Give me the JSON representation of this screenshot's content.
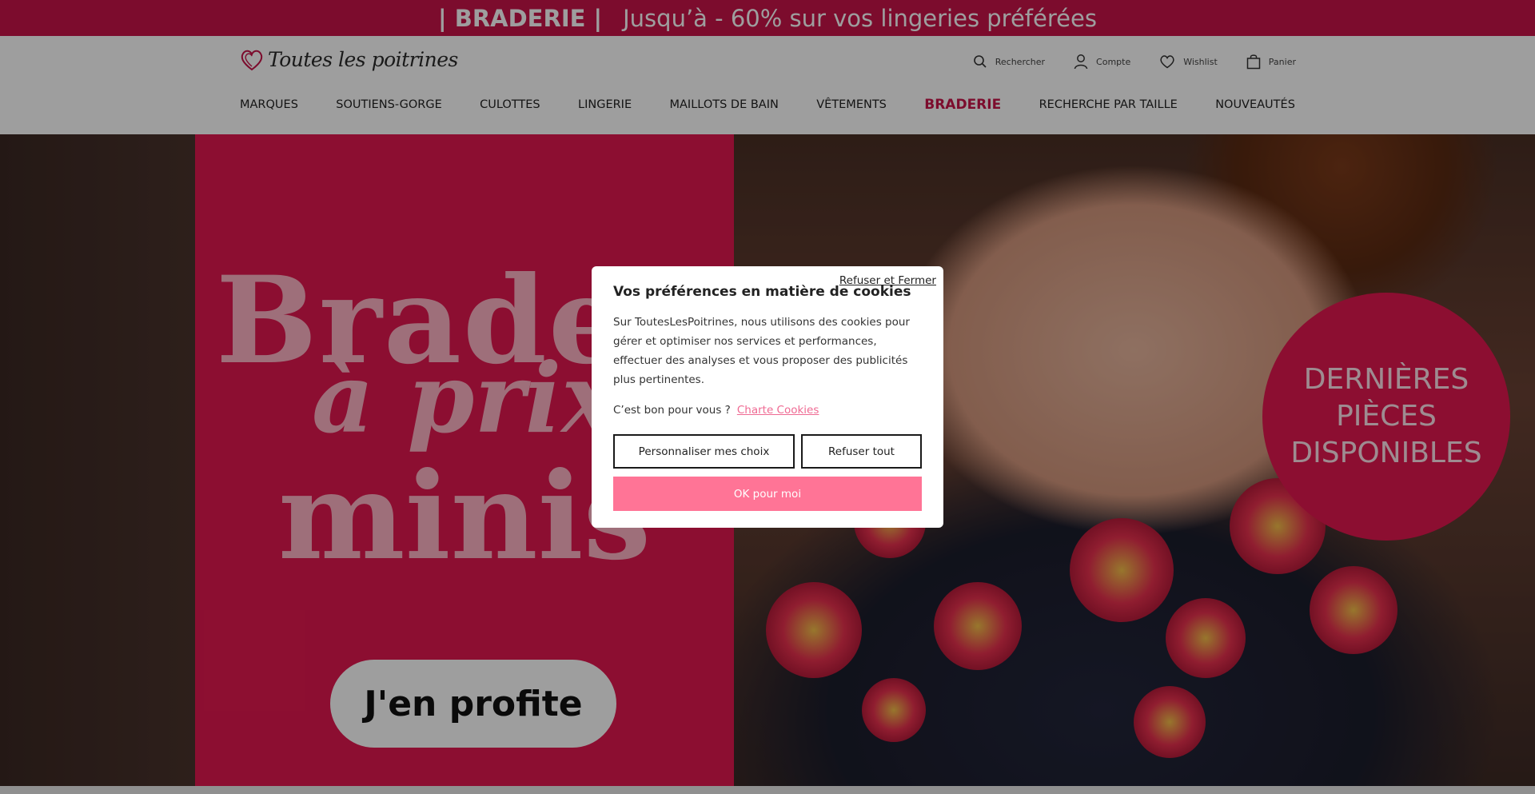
{
  "promo": {
    "highlight": "| BRADERIE |",
    "text": "Jusqu’à - 60% sur vos lingeries préférées"
  },
  "header": {
    "logo_text": "Toutes les poitrines",
    "utils": {
      "search": "Rechercher",
      "account": "Compte",
      "wishlist": "Wishlist",
      "cart": "Panier"
    },
    "nav": [
      {
        "label": "MARQUES"
      },
      {
        "label": "SOUTIENS-GORGE"
      },
      {
        "label": "CULOTTES"
      },
      {
        "label": "LINGERIE"
      },
      {
        "label": "MAILLOTS DE BAIN"
      },
      {
        "label": "VÊTEMENTS"
      },
      {
        "label": "BRADERIE",
        "highlight": true
      },
      {
        "label": "RECHERCHE PAR TAILLE"
      },
      {
        "label": "NOUVEAUTÉS"
      }
    ]
  },
  "hero": {
    "line1": "Braderie",
    "line2": "à prix",
    "line3": "minis",
    "cta": "J'en profite",
    "badge": {
      "line1": "DERNIÈRES",
      "line2": "PIÈCES",
      "line3": "DISPONIBLES"
    }
  },
  "cookie_modal": {
    "close_label": "Refuser et Fermer",
    "title": "Vos préférences en matière de cookies",
    "body": "Sur ToutesLesPoitrines, nous utilisons des cookies pour gérer et optimiser nos services et performances, effectuer des analyses et vous proposer des publicités plus pertinentes.",
    "question": "C’est bon pour vous ?",
    "link": "Charte Cookies",
    "btn_customize": "Personnaliser mes choix",
    "btn_refuse": "Refuser tout",
    "btn_ok": "OK pour moi"
  },
  "colors": {
    "brand": "#c8144a",
    "hero_red": "#e3184f",
    "ok_button": "#ff7496",
    "link": "#ef6a93"
  }
}
